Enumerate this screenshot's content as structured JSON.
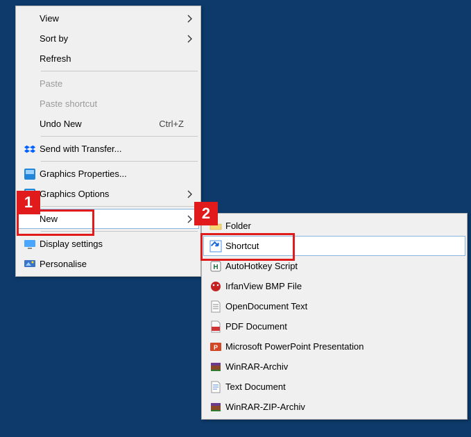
{
  "menu1": {
    "items": [
      {
        "label": "View",
        "hasArrow": true
      },
      {
        "label": "Sort by",
        "hasArrow": true
      },
      {
        "label": "Refresh"
      }
    ],
    "items2": [
      {
        "label": "Paste",
        "disabled": true
      },
      {
        "label": "Paste shortcut",
        "disabled": true
      },
      {
        "label": "Undo New",
        "shortcut": "Ctrl+Z"
      }
    ],
    "items3": [
      {
        "label": "Send with Transfer..."
      }
    ],
    "items4": [
      {
        "label": "Graphics Properties..."
      },
      {
        "label": "Graphics Options",
        "hasArrow": true
      }
    ],
    "items5": [
      {
        "label": "New",
        "hasArrow": true,
        "hovered": true
      }
    ],
    "items6": [
      {
        "label": "Display settings"
      },
      {
        "label": "Personalise"
      }
    ]
  },
  "menu2": {
    "items": [
      {
        "label": "Folder"
      },
      {
        "label": "Shortcut",
        "hovered": true
      },
      {
        "label": "AutoHotkey Script"
      },
      {
        "label": "IrfanView BMP File"
      },
      {
        "label": "OpenDocument Text"
      },
      {
        "label": "PDF Document"
      },
      {
        "label": "Microsoft PowerPoint Presentation"
      },
      {
        "label": "WinRAR-Archiv"
      },
      {
        "label": "Text Document"
      },
      {
        "label": "WinRAR-ZIP-Archiv"
      }
    ]
  },
  "markers": {
    "one": "1",
    "two": "2"
  }
}
